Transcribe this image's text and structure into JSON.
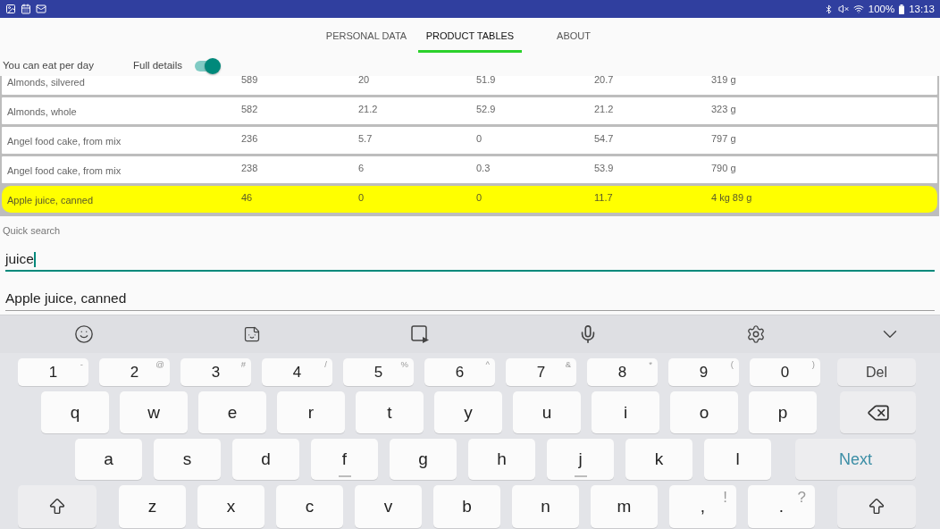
{
  "status_bar": {
    "battery": "100%",
    "time": "13:13"
  },
  "tabs": [
    {
      "label": "PERSONAL DATA",
      "selected": false
    },
    {
      "label": "PRODUCT TABLES",
      "selected": true
    },
    {
      "label": "ABOUT",
      "selected": false
    }
  ],
  "daily": {
    "label": "You can eat per day",
    "toggle": {
      "label": "Full details",
      "on": true
    }
  },
  "table": {
    "rows": [
      {
        "name": "Almonds, silvered",
        "values": [
          "589",
          "20",
          "51.9",
          "20.7",
          "319 g"
        ],
        "selected": false
      },
      {
        "name": "Almonds, whole",
        "values": [
          "582",
          "21.2",
          "52.9",
          "21.2",
          "323 g"
        ],
        "selected": false
      },
      {
        "name": "Angel food cake, from mix",
        "values": [
          "236",
          "5.7",
          "0",
          "54.7",
          "797 g"
        ],
        "selected": false
      },
      {
        "name": "Angel food cake, from mix",
        "values": [
          "238",
          "6",
          "0.3",
          "53.9",
          "790 g"
        ],
        "selected": false
      },
      {
        "name": "Apple juice, canned",
        "values": [
          "46",
          "0",
          "0",
          "11.7",
          "4 kg 89 g"
        ],
        "selected": true
      }
    ]
  },
  "search": {
    "label": "Quick search",
    "value": "juice",
    "suggestion": "Apple juice, canned"
  },
  "keyboard": {
    "rows": [
      [
        {
          "kind": "char",
          "label": "1",
          "hint": "-"
        },
        {
          "kind": "char",
          "label": "2",
          "hint": "@"
        },
        {
          "kind": "char",
          "label": "3",
          "hint": "#"
        },
        {
          "kind": "char",
          "label": "4",
          "hint": "/"
        },
        {
          "kind": "char",
          "label": "5",
          "hint": "%"
        },
        {
          "kind": "char",
          "label": "6",
          "hint": "^"
        },
        {
          "kind": "char",
          "label": "7",
          "hint": "&"
        },
        {
          "kind": "char",
          "label": "8",
          "hint": "*"
        },
        {
          "kind": "char",
          "label": "9",
          "hint": "("
        },
        {
          "kind": "char",
          "label": "0",
          "hint": ")"
        },
        {
          "kind": "function",
          "label": "Del"
        }
      ],
      [
        {
          "kind": "char",
          "label": "q"
        },
        {
          "kind": "char",
          "label": "w"
        },
        {
          "kind": "char",
          "label": "e"
        },
        {
          "kind": "char",
          "label": "r"
        },
        {
          "kind": "char",
          "label": "t"
        },
        {
          "kind": "char",
          "label": "y"
        },
        {
          "kind": "char",
          "label": "u"
        },
        {
          "kind": "char",
          "label": "i"
        },
        {
          "kind": "char",
          "label": "o"
        },
        {
          "kind": "char",
          "label": "p"
        },
        {
          "kind": "backspace"
        }
      ],
      [
        {
          "kind": "char",
          "label": "a"
        },
        {
          "kind": "char",
          "label": "s"
        },
        {
          "kind": "char",
          "label": "d"
        },
        {
          "kind": "homing",
          "label": "f"
        },
        {
          "kind": "char",
          "label": "g"
        },
        {
          "kind": "char",
          "label": "h"
        },
        {
          "kind": "homing",
          "label": "j"
        },
        {
          "kind": "char",
          "label": "k"
        },
        {
          "kind": "char",
          "label": "l"
        },
        {
          "kind": "action",
          "label": "Next"
        }
      ],
      [
        {
          "kind": "shift"
        },
        {
          "kind": "char",
          "label": "z"
        },
        {
          "kind": "char",
          "label": "x"
        },
        {
          "kind": "char",
          "label": "c"
        },
        {
          "kind": "char",
          "label": "v"
        },
        {
          "kind": "char",
          "label": "b"
        },
        {
          "kind": "char",
          "label": "n"
        },
        {
          "kind": "char",
          "label": "m"
        },
        {
          "kind": "char",
          "label": ",",
          "hint": "!"
        },
        {
          "kind": "char",
          "label": ".",
          "hint": "?"
        },
        {
          "kind": "shift"
        }
      ]
    ]
  }
}
